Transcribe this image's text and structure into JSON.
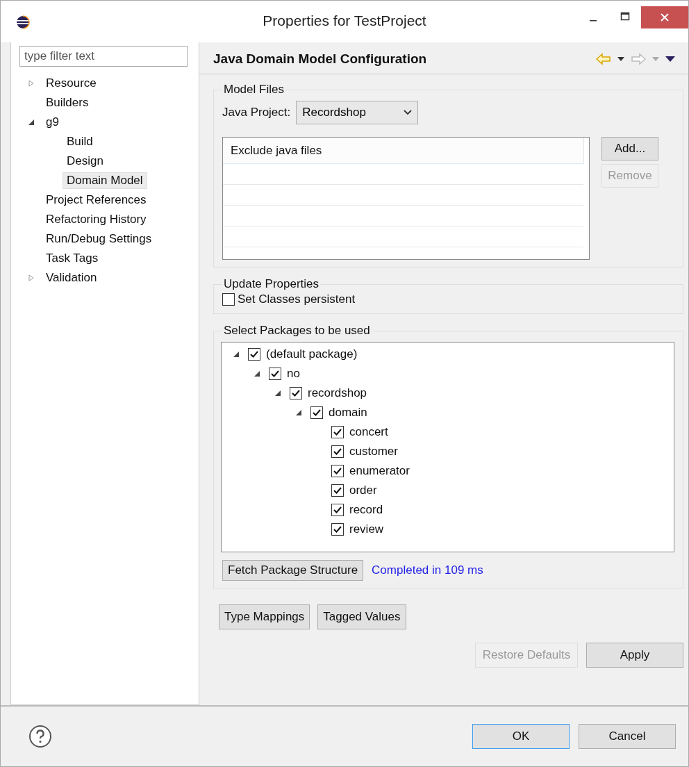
{
  "window": {
    "title": "Properties for TestProject"
  },
  "filter": {
    "placeholder": "type filter text"
  },
  "sidebar": {
    "items": [
      {
        "label": "Resource",
        "selected": false,
        "expanded": false
      },
      {
        "label": "Builders",
        "selected": false
      },
      {
        "label": "g9",
        "selected": false,
        "expanded": true,
        "children": [
          {
            "label": "Build",
            "selected": false
          },
          {
            "label": "Design",
            "selected": false
          },
          {
            "label": "Domain Model",
            "selected": true
          }
        ]
      },
      {
        "label": "Project References",
        "selected": false
      },
      {
        "label": "Refactoring History",
        "selected": false
      },
      {
        "label": "Run/Debug Settings",
        "selected": false
      },
      {
        "label": "Task Tags",
        "selected": false
      },
      {
        "label": "Validation",
        "selected": false,
        "expanded": false
      }
    ]
  },
  "page": {
    "title": "Java Domain Model Configuration"
  },
  "model_files": {
    "title": "Model Files",
    "project_label": "Java Project:",
    "project_value": "Recordshop",
    "table": {
      "columns": [
        "Exclude java files"
      ]
    },
    "buttons": [
      {
        "label": "Add...",
        "disabled": false
      },
      {
        "label": "Remove",
        "disabled": true
      }
    ]
  },
  "update_properties": {
    "title": "Update Properties",
    "checkbox": {
      "label": "Set Classes persistent",
      "checked": false
    }
  },
  "packages": {
    "title": "Select Packages to be used",
    "tree": [
      {
        "label": "(default package)",
        "checked": true,
        "expanded": true,
        "children": [
          {
            "label": "no",
            "checked": true,
            "expanded": true,
            "children": [
              {
                "label": "recordshop",
                "checked": true,
                "expanded": true,
                "children": [
                  {
                    "label": "domain",
                    "checked": true,
                    "expanded": true,
                    "children": [
                      {
                        "label": "concert",
                        "checked": true
                      },
                      {
                        "label": "customer",
                        "checked": true
                      },
                      {
                        "label": "enumerator",
                        "checked": true
                      },
                      {
                        "label": "order",
                        "checked": true
                      },
                      {
                        "label": "record",
                        "checked": true
                      },
                      {
                        "label": "review",
                        "checked": true
                      }
                    ]
                  }
                ]
              }
            ]
          }
        ]
      }
    ],
    "fetch_button": "Fetch Package Structure",
    "status": "Completed in 109 ms"
  },
  "extra_buttons": [
    "Type Mappings",
    "Tagged Values"
  ],
  "page_buttons": [
    {
      "label": "Restore Defaults",
      "disabled": true
    },
    {
      "label": "Apply",
      "disabled": false
    }
  ],
  "dialog_buttons": [
    {
      "label": "OK",
      "default": true
    },
    {
      "label": "Cancel",
      "default": false
    }
  ]
}
